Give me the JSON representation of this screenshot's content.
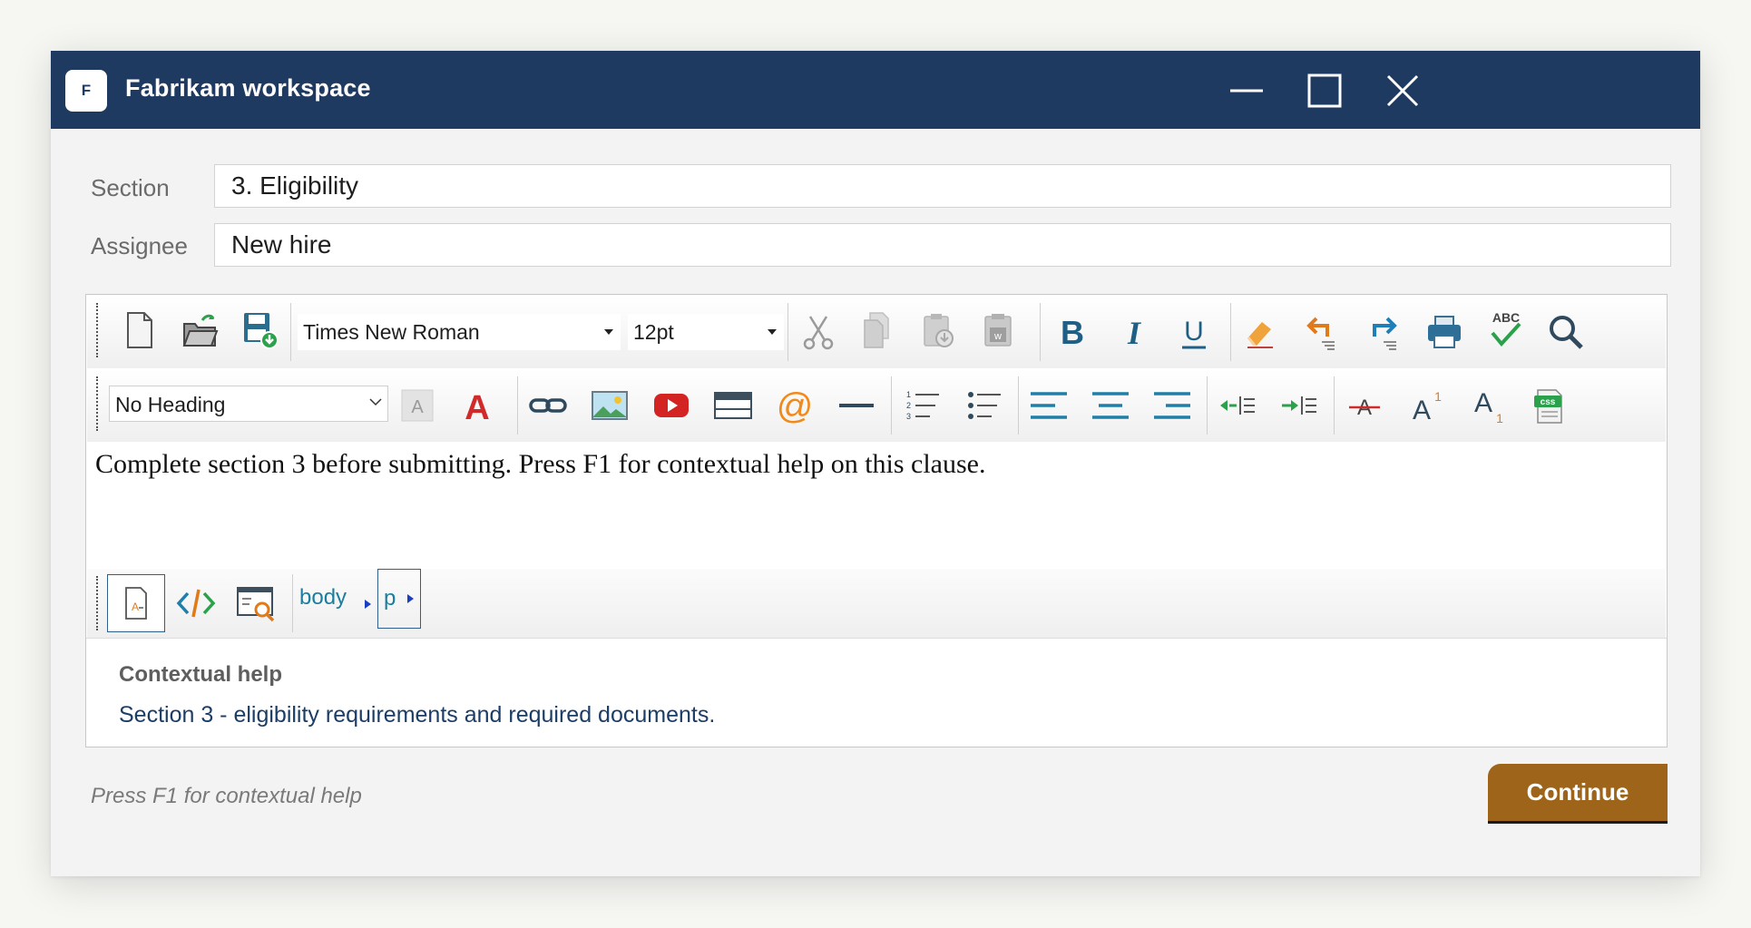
{
  "window": {
    "badge": "F",
    "title": "Fabrikam workspace"
  },
  "form": {
    "section_label": "Section",
    "section_value": "3. Eligibility",
    "assignee_label": "Assignee",
    "assignee_value": "New hire"
  },
  "toolbar1": {
    "font_family": "Times New Roman",
    "font_size": "12pt",
    "spellcheck_text": "ABC"
  },
  "toolbar2": {
    "heading": "No Heading",
    "css_badge": "css",
    "superscript_mark": "1",
    "subscript_mark": "1"
  },
  "editor": {
    "content": "Complete section 3 before submitting. Press F1 for contextual help on this clause."
  },
  "pathbar": {
    "crumbs": [
      "body",
      "p"
    ]
  },
  "help": {
    "title": "Contextual help",
    "body": "Section 3 - eligibility requirements and required documents."
  },
  "footer": {
    "hint": "Press F1 for contextual help",
    "continue_label": "Continue"
  },
  "colors": {
    "titlebar": "#1e3a60",
    "accent_button": "#9e6419",
    "link_teal": "#1a7e9e"
  }
}
